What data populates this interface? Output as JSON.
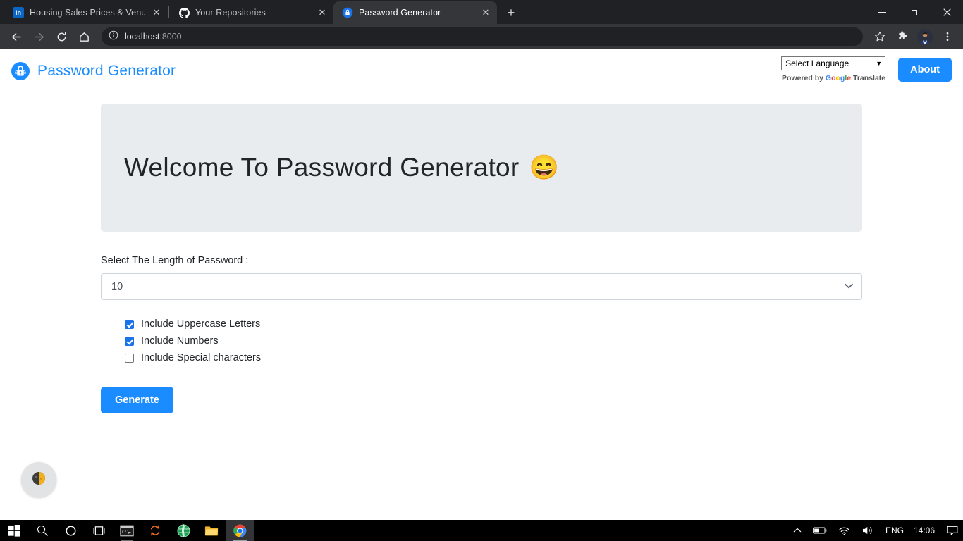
{
  "browser": {
    "tabs": [
      {
        "title": "Housing Sales Prices & Venues D",
        "favicon": "linkedin-icon",
        "active": false
      },
      {
        "title": "Your Repositories",
        "favicon": "github-icon",
        "active": false
      },
      {
        "title": "Password Generator",
        "favicon": "lock-icon",
        "active": true
      }
    ],
    "new_tab_label": "+",
    "window_controls": {
      "minimize": "—",
      "maximize": "❐",
      "close": "✕"
    },
    "nav": {
      "back": "back-icon",
      "forward": "forward-icon",
      "reload": "reload-icon",
      "home": "home-icon"
    },
    "omnibox": {
      "info_icon": "info-icon",
      "url_host": "localhost",
      "url_port": ":8000"
    },
    "toolbar_right": {
      "bookmark": "star-icon",
      "extensions": "puzzle-icon",
      "profile": "avatar",
      "menu": "three-dots-icon"
    }
  },
  "site": {
    "brand": {
      "logo": "lock-circle-icon",
      "name": "Password Generator"
    },
    "translate": {
      "selected_language": "Select Language",
      "caret": "▾",
      "powered_prefix": "Powered by",
      "google": [
        "G",
        "o",
        "o",
        "g",
        "l",
        "e"
      ],
      "translate_word": "Translate"
    },
    "about_label": "About",
    "jumbotron": {
      "title": "Welcome To Password Generator",
      "emoji": "😄"
    },
    "form": {
      "length_label": "Select The Length of Password :",
      "length_value": "10",
      "length_caret": "⌄",
      "checkboxes": [
        {
          "label": "Include Uppercase Letters",
          "checked": true
        },
        {
          "label": "Include Numbers",
          "checked": true
        },
        {
          "label": "Include Special characters",
          "checked": false
        }
      ],
      "generate_label": "Generate"
    },
    "accessibility_widget": "contrast-toggle-icon"
  },
  "taskbar": {
    "items": [
      {
        "name": "start-button",
        "icon": "windows-icon"
      },
      {
        "name": "search-button",
        "icon": "search-icon"
      },
      {
        "name": "cortana-button",
        "icon": "circle-icon"
      },
      {
        "name": "task-view-button",
        "icon": "task-view-icon"
      },
      {
        "name": "command-prompt",
        "icon": "terminal-icon"
      },
      {
        "name": "sync-app",
        "icon": "orange-arrows-icon"
      },
      {
        "name": "browser-app",
        "icon": "green-globe-icon"
      },
      {
        "name": "file-explorer",
        "icon": "folder-icon"
      },
      {
        "name": "chrome-browser",
        "icon": "chrome-icon"
      }
    ],
    "tray": {
      "show_hidden": "chevron-up-icon",
      "battery": "battery-icon",
      "network": "wifi-icon",
      "volume": "speaker-icon",
      "language": "ENG",
      "clock": "14:06",
      "action_center": "notification-icon"
    }
  }
}
